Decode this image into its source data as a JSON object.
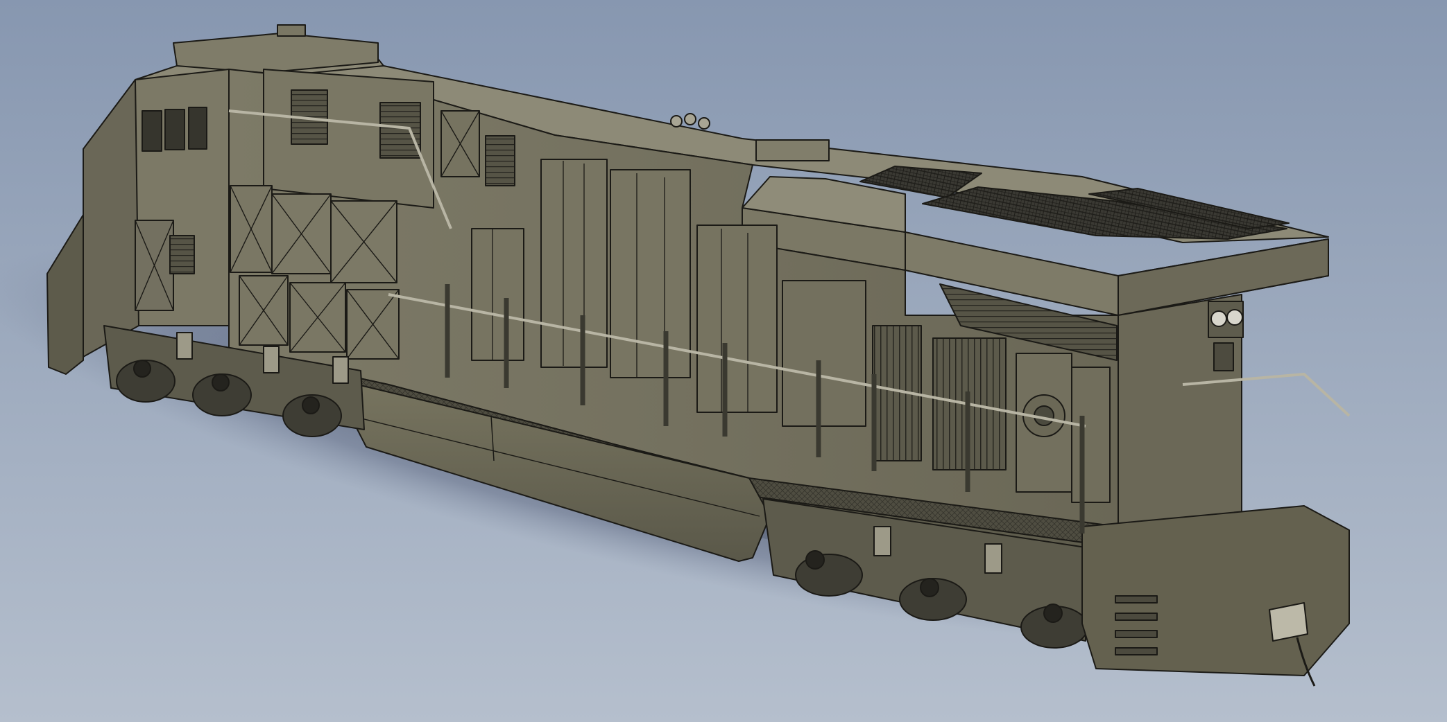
{
  "scene": {
    "subject": "locomotive",
    "render_style": "shaded-with-edges",
    "view": "isometric"
  },
  "colors": {
    "background_top": "#8797b0",
    "background_bottom": "#b3bdcc",
    "body_light": "#85826f",
    "body_mid": "#6f6c5c",
    "body_dark": "#4a483d",
    "roof_grille": "#2d2c27",
    "edge_line": "#1b1a16",
    "metal_highlight": "#c9c6b6",
    "shadow": "#4f586a"
  },
  "icons": {
    "headlight": "headlight-icon",
    "horn": "horn-icon",
    "coupler": "coupler-icon",
    "wheel": "wheel-icon"
  }
}
